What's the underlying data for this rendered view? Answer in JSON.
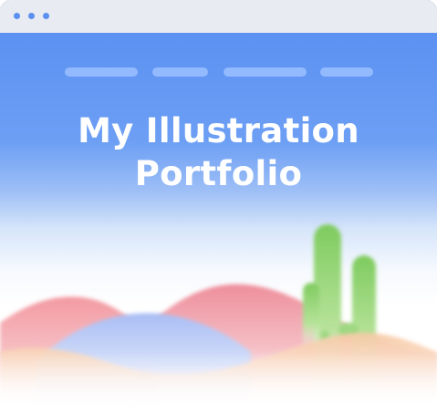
{
  "window": {
    "controls": [
      "dot",
      "dot",
      "dot"
    ],
    "titlebar_color": "#e8ebf1",
    "control_color": "#5b8ff1"
  },
  "site": {
    "nav": [
      {
        "name": "nav-link-1",
        "label": ""
      },
      {
        "name": "nav-link-2",
        "label": ""
      },
      {
        "name": "nav-link-3",
        "label": ""
      },
      {
        "name": "nav-link-4",
        "label": ""
      }
    ],
    "headline_line1": "My Illustration",
    "headline_line2": "Portfolio"
  },
  "colors": {
    "hero_blue": "#5b91f2",
    "nav_pill": "#9cc1ff",
    "hill_pink": "#f0a0a8",
    "hill_blue": "#b8c9f5",
    "cactus_green": "#8fd16f"
  },
  "illustration": {
    "elements": [
      "desert-hills",
      "cactus"
    ]
  }
}
